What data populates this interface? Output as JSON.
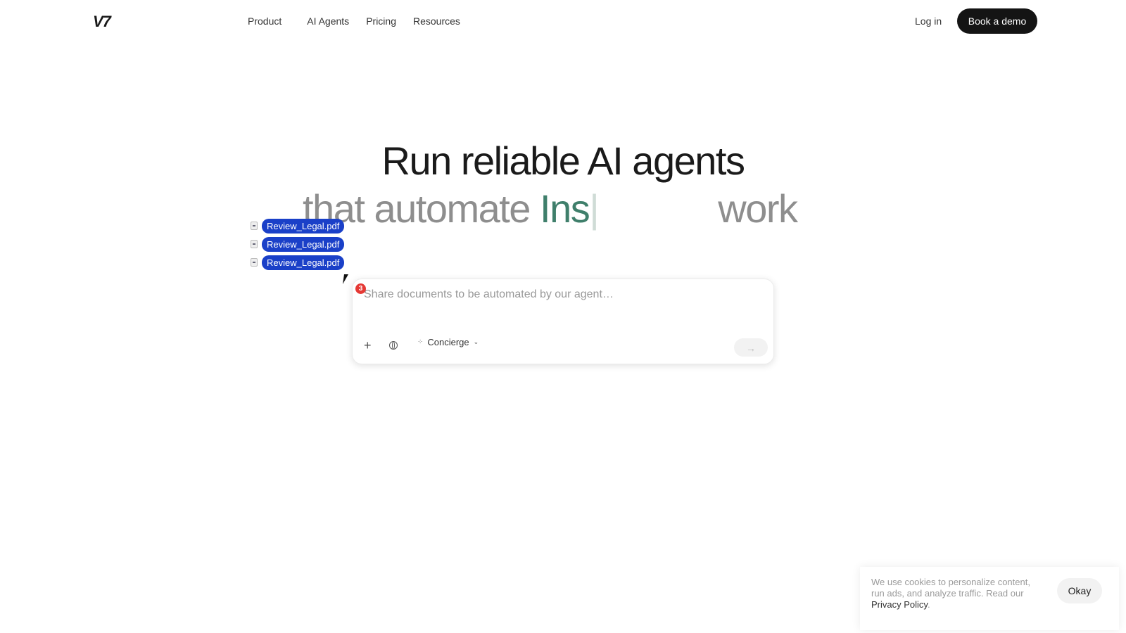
{
  "header": {
    "logo": "V7",
    "nav": [
      "Product",
      "AI Agents",
      "Pricing",
      "Resources"
    ],
    "login": "Log in",
    "demo": "Book a demo"
  },
  "hero": {
    "line1": "Run reliable AI agents",
    "line2_start": "that automate ",
    "line2_typed": "Ins",
    "line2_caret": "|",
    "line2_end": "work"
  },
  "files": [
    "Review_Legal.pdf",
    "Review_Legal.pdf",
    "Review_Legal.pdf"
  ],
  "composer": {
    "badge": "3",
    "placeholder": "Share documents to be automated by our agent…",
    "agent": "Concierge"
  },
  "cookie": {
    "text": "We use cookies to personalize content, run ads, and analyze traffic. Read our ",
    "link": "Privacy Policy",
    "end": ".",
    "button": "Okay"
  },
  "colors": {
    "primary_button": "#141414",
    "file_chip": "#1a40c8",
    "typed_accent": "#3f7f6b",
    "badge": "#e53935"
  }
}
